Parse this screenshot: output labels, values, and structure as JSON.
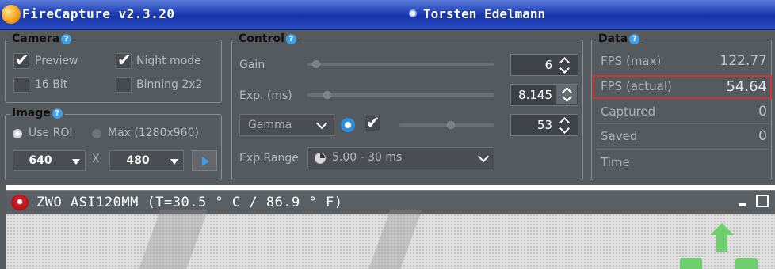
{
  "titlebar": {
    "app_title": "FireCapture v2.3.20",
    "author": "Torsten Edelmann"
  },
  "camera": {
    "legend": "Camera",
    "preview_label": "Preview",
    "preview_checked": true,
    "night_mode_label": "Night mode",
    "night_mode_checked": true,
    "bit16_label": "16 Bit",
    "bit16_checked": false,
    "binning_label": "Binning 2x2",
    "binning_checked": false
  },
  "image": {
    "legend": "Image",
    "use_roi_label": "Use ROI",
    "max_label": "Max (1280x960)",
    "width_value": "640",
    "x_label": "X",
    "height_value": "480"
  },
  "control": {
    "legend": "Control",
    "gain_label": "Gain",
    "gain_value": "6",
    "exp_label": "Exp. (ms)",
    "exp_value": "8.145",
    "gamma_label": "Gamma",
    "gamma_value": "53",
    "exp_range_label": "Exp.Range",
    "exp_range_value": "5.00 - 30 ms"
  },
  "data": {
    "legend": "Data",
    "fps_max_label": "FPS (max)",
    "fps_max_value": "122.77",
    "fps_actual_label": "FPS (actual)",
    "fps_actual_value": "54.64",
    "captured_label": "Captured",
    "captured_value": "0",
    "saved_label": "Saved",
    "saved_value": "0",
    "time_label": "Time"
  },
  "camera_window": {
    "title": "ZWO ASI120MM  (T=30.5 ° C / 86.9 ° F)"
  },
  "help_glyph": "?"
}
